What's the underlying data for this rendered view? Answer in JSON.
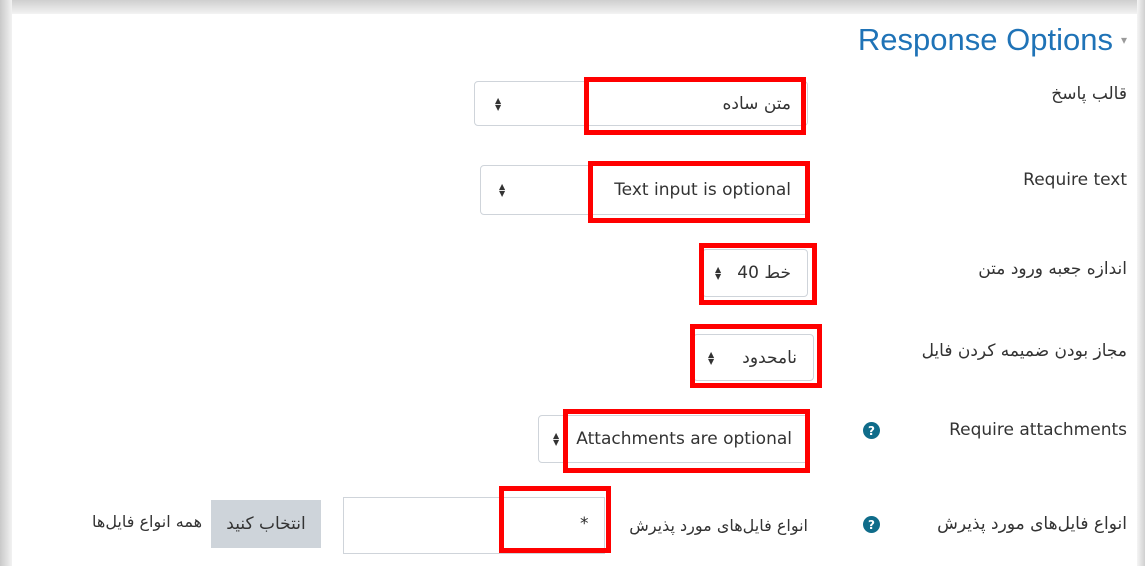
{
  "section": {
    "title": "Response Options"
  },
  "fields": {
    "response_format": {
      "label": "قالب پاسخ",
      "value": "متن ساده"
    },
    "require_text": {
      "label": "Require text",
      "value": "Text input is optional"
    },
    "input_box_size": {
      "label": "اندازه جعبه ورود متن",
      "value": "40 خط"
    },
    "attachments_allowed": {
      "label": "مجاز بودن ضمیمه کردن فایل",
      "value": "نامحدود"
    },
    "require_attachments": {
      "label": "Require attachments",
      "value": "Attachments are optional"
    },
    "accepted_file_types": {
      "label": "انواع فایل‌های مورد پذیرش",
      "inner_label": "انواع فایل‌های مورد پذیرش",
      "value": "*",
      "choose_button": "انتخاب کنید",
      "all_types_text": "همه انواع فایل‌ها"
    }
  },
  "help_icon_glyph": "?",
  "colors": {
    "title": "#1f73b7",
    "highlight": "#ff0000",
    "help_icon": "#0f6c8a",
    "choose_button_bg": "#ced4da"
  },
  "icons": {
    "select_arrows": "sort-arrows-icon",
    "help": "help-circle-icon",
    "section_chevron": "chevron-down-icon"
  }
}
